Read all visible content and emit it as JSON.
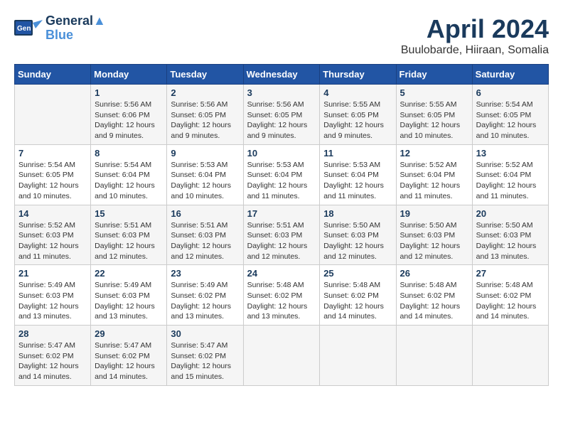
{
  "logo": {
    "line1": "General",
    "line2": "Blue"
  },
  "title": "April 2024",
  "location": "Buulobarde, Hiiraan, Somalia",
  "days_of_week": [
    "Sunday",
    "Monday",
    "Tuesday",
    "Wednesday",
    "Thursday",
    "Friday",
    "Saturday"
  ],
  "weeks": [
    [
      {
        "day": "",
        "info": ""
      },
      {
        "day": "1",
        "info": "Sunrise: 5:56 AM\nSunset: 6:06 PM\nDaylight: 12 hours\nand 9 minutes."
      },
      {
        "day": "2",
        "info": "Sunrise: 5:56 AM\nSunset: 6:05 PM\nDaylight: 12 hours\nand 9 minutes."
      },
      {
        "day": "3",
        "info": "Sunrise: 5:56 AM\nSunset: 6:05 PM\nDaylight: 12 hours\nand 9 minutes."
      },
      {
        "day": "4",
        "info": "Sunrise: 5:55 AM\nSunset: 6:05 PM\nDaylight: 12 hours\nand 9 minutes."
      },
      {
        "day": "5",
        "info": "Sunrise: 5:55 AM\nSunset: 6:05 PM\nDaylight: 12 hours\nand 10 minutes."
      },
      {
        "day": "6",
        "info": "Sunrise: 5:54 AM\nSunset: 6:05 PM\nDaylight: 12 hours\nand 10 minutes."
      }
    ],
    [
      {
        "day": "7",
        "info": "Sunrise: 5:54 AM\nSunset: 6:05 PM\nDaylight: 12 hours\nand 10 minutes."
      },
      {
        "day": "8",
        "info": "Sunrise: 5:54 AM\nSunset: 6:04 PM\nDaylight: 12 hours\nand 10 minutes."
      },
      {
        "day": "9",
        "info": "Sunrise: 5:53 AM\nSunset: 6:04 PM\nDaylight: 12 hours\nand 10 minutes."
      },
      {
        "day": "10",
        "info": "Sunrise: 5:53 AM\nSunset: 6:04 PM\nDaylight: 12 hours\nand 11 minutes."
      },
      {
        "day": "11",
        "info": "Sunrise: 5:53 AM\nSunset: 6:04 PM\nDaylight: 12 hours\nand 11 minutes."
      },
      {
        "day": "12",
        "info": "Sunrise: 5:52 AM\nSunset: 6:04 PM\nDaylight: 12 hours\nand 11 minutes."
      },
      {
        "day": "13",
        "info": "Sunrise: 5:52 AM\nSunset: 6:04 PM\nDaylight: 12 hours\nand 11 minutes."
      }
    ],
    [
      {
        "day": "14",
        "info": "Sunrise: 5:52 AM\nSunset: 6:03 PM\nDaylight: 12 hours\nand 11 minutes."
      },
      {
        "day": "15",
        "info": "Sunrise: 5:51 AM\nSunset: 6:03 PM\nDaylight: 12 hours\nand 12 minutes."
      },
      {
        "day": "16",
        "info": "Sunrise: 5:51 AM\nSunset: 6:03 PM\nDaylight: 12 hours\nand 12 minutes."
      },
      {
        "day": "17",
        "info": "Sunrise: 5:51 AM\nSunset: 6:03 PM\nDaylight: 12 hours\nand 12 minutes."
      },
      {
        "day": "18",
        "info": "Sunrise: 5:50 AM\nSunset: 6:03 PM\nDaylight: 12 hours\nand 12 minutes."
      },
      {
        "day": "19",
        "info": "Sunrise: 5:50 AM\nSunset: 6:03 PM\nDaylight: 12 hours\nand 12 minutes."
      },
      {
        "day": "20",
        "info": "Sunrise: 5:50 AM\nSunset: 6:03 PM\nDaylight: 12 hours\nand 13 minutes."
      }
    ],
    [
      {
        "day": "21",
        "info": "Sunrise: 5:49 AM\nSunset: 6:03 PM\nDaylight: 12 hours\nand 13 minutes."
      },
      {
        "day": "22",
        "info": "Sunrise: 5:49 AM\nSunset: 6:03 PM\nDaylight: 12 hours\nand 13 minutes."
      },
      {
        "day": "23",
        "info": "Sunrise: 5:49 AM\nSunset: 6:02 PM\nDaylight: 12 hours\nand 13 minutes."
      },
      {
        "day": "24",
        "info": "Sunrise: 5:48 AM\nSunset: 6:02 PM\nDaylight: 12 hours\nand 13 minutes."
      },
      {
        "day": "25",
        "info": "Sunrise: 5:48 AM\nSunset: 6:02 PM\nDaylight: 12 hours\nand 14 minutes."
      },
      {
        "day": "26",
        "info": "Sunrise: 5:48 AM\nSunset: 6:02 PM\nDaylight: 12 hours\nand 14 minutes."
      },
      {
        "day": "27",
        "info": "Sunrise: 5:48 AM\nSunset: 6:02 PM\nDaylight: 12 hours\nand 14 minutes."
      }
    ],
    [
      {
        "day": "28",
        "info": "Sunrise: 5:47 AM\nSunset: 6:02 PM\nDaylight: 12 hours\nand 14 minutes."
      },
      {
        "day": "29",
        "info": "Sunrise: 5:47 AM\nSunset: 6:02 PM\nDaylight: 12 hours\nand 14 minutes."
      },
      {
        "day": "30",
        "info": "Sunrise: 5:47 AM\nSunset: 6:02 PM\nDaylight: 12 hours\nand 15 minutes."
      },
      {
        "day": "",
        "info": ""
      },
      {
        "day": "",
        "info": ""
      },
      {
        "day": "",
        "info": ""
      },
      {
        "day": "",
        "info": ""
      }
    ]
  ]
}
